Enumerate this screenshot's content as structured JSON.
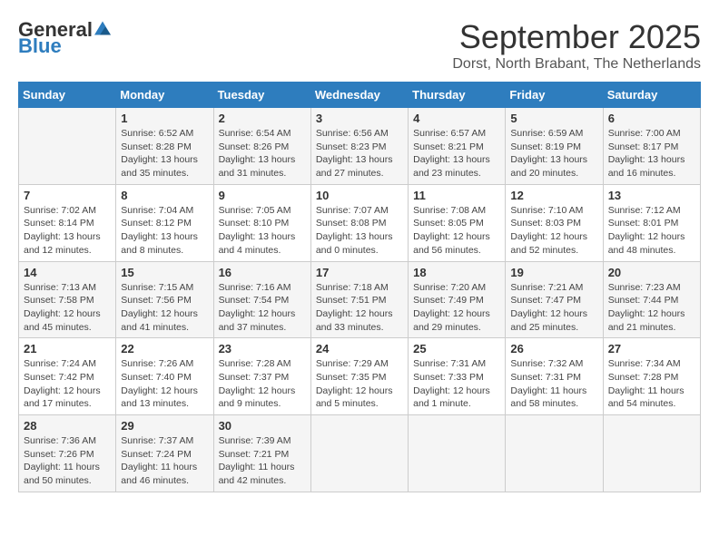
{
  "logo": {
    "general": "General",
    "blue": "Blue"
  },
  "title": "September 2025",
  "location": "Dorst, North Brabant, The Netherlands",
  "days_header": [
    "Sunday",
    "Monday",
    "Tuesday",
    "Wednesday",
    "Thursday",
    "Friday",
    "Saturday"
  ],
  "weeks": [
    [
      {
        "day": "",
        "info": ""
      },
      {
        "day": "1",
        "info": "Sunrise: 6:52 AM\nSunset: 8:28 PM\nDaylight: 13 hours and 35 minutes."
      },
      {
        "day": "2",
        "info": "Sunrise: 6:54 AM\nSunset: 8:26 PM\nDaylight: 13 hours and 31 minutes."
      },
      {
        "day": "3",
        "info": "Sunrise: 6:56 AM\nSunset: 8:23 PM\nDaylight: 13 hours and 27 minutes."
      },
      {
        "day": "4",
        "info": "Sunrise: 6:57 AM\nSunset: 8:21 PM\nDaylight: 13 hours and 23 minutes."
      },
      {
        "day": "5",
        "info": "Sunrise: 6:59 AM\nSunset: 8:19 PM\nDaylight: 13 hours and 20 minutes."
      },
      {
        "day": "6",
        "info": "Sunrise: 7:00 AM\nSunset: 8:17 PM\nDaylight: 13 hours and 16 minutes."
      }
    ],
    [
      {
        "day": "7",
        "info": "Sunrise: 7:02 AM\nSunset: 8:14 PM\nDaylight: 13 hours and 12 minutes."
      },
      {
        "day": "8",
        "info": "Sunrise: 7:04 AM\nSunset: 8:12 PM\nDaylight: 13 hours and 8 minutes."
      },
      {
        "day": "9",
        "info": "Sunrise: 7:05 AM\nSunset: 8:10 PM\nDaylight: 13 hours and 4 minutes."
      },
      {
        "day": "10",
        "info": "Sunrise: 7:07 AM\nSunset: 8:08 PM\nDaylight: 13 hours and 0 minutes."
      },
      {
        "day": "11",
        "info": "Sunrise: 7:08 AM\nSunset: 8:05 PM\nDaylight: 12 hours and 56 minutes."
      },
      {
        "day": "12",
        "info": "Sunrise: 7:10 AM\nSunset: 8:03 PM\nDaylight: 12 hours and 52 minutes."
      },
      {
        "day": "13",
        "info": "Sunrise: 7:12 AM\nSunset: 8:01 PM\nDaylight: 12 hours and 48 minutes."
      }
    ],
    [
      {
        "day": "14",
        "info": "Sunrise: 7:13 AM\nSunset: 7:58 PM\nDaylight: 12 hours and 45 minutes."
      },
      {
        "day": "15",
        "info": "Sunrise: 7:15 AM\nSunset: 7:56 PM\nDaylight: 12 hours and 41 minutes."
      },
      {
        "day": "16",
        "info": "Sunrise: 7:16 AM\nSunset: 7:54 PM\nDaylight: 12 hours and 37 minutes."
      },
      {
        "day": "17",
        "info": "Sunrise: 7:18 AM\nSunset: 7:51 PM\nDaylight: 12 hours and 33 minutes."
      },
      {
        "day": "18",
        "info": "Sunrise: 7:20 AM\nSunset: 7:49 PM\nDaylight: 12 hours and 29 minutes."
      },
      {
        "day": "19",
        "info": "Sunrise: 7:21 AM\nSunset: 7:47 PM\nDaylight: 12 hours and 25 minutes."
      },
      {
        "day": "20",
        "info": "Sunrise: 7:23 AM\nSunset: 7:44 PM\nDaylight: 12 hours and 21 minutes."
      }
    ],
    [
      {
        "day": "21",
        "info": "Sunrise: 7:24 AM\nSunset: 7:42 PM\nDaylight: 12 hours and 17 minutes."
      },
      {
        "day": "22",
        "info": "Sunrise: 7:26 AM\nSunset: 7:40 PM\nDaylight: 12 hours and 13 minutes."
      },
      {
        "day": "23",
        "info": "Sunrise: 7:28 AM\nSunset: 7:37 PM\nDaylight: 12 hours and 9 minutes."
      },
      {
        "day": "24",
        "info": "Sunrise: 7:29 AM\nSunset: 7:35 PM\nDaylight: 12 hours and 5 minutes."
      },
      {
        "day": "25",
        "info": "Sunrise: 7:31 AM\nSunset: 7:33 PM\nDaylight: 12 hours and 1 minute."
      },
      {
        "day": "26",
        "info": "Sunrise: 7:32 AM\nSunset: 7:31 PM\nDaylight: 11 hours and 58 minutes."
      },
      {
        "day": "27",
        "info": "Sunrise: 7:34 AM\nSunset: 7:28 PM\nDaylight: 11 hours and 54 minutes."
      }
    ],
    [
      {
        "day": "28",
        "info": "Sunrise: 7:36 AM\nSunset: 7:26 PM\nDaylight: 11 hours and 50 minutes."
      },
      {
        "day": "29",
        "info": "Sunrise: 7:37 AM\nSunset: 7:24 PM\nDaylight: 11 hours and 46 minutes."
      },
      {
        "day": "30",
        "info": "Sunrise: 7:39 AM\nSunset: 7:21 PM\nDaylight: 11 hours and 42 minutes."
      },
      {
        "day": "",
        "info": ""
      },
      {
        "day": "",
        "info": ""
      },
      {
        "day": "",
        "info": ""
      },
      {
        "day": "",
        "info": ""
      }
    ]
  ]
}
